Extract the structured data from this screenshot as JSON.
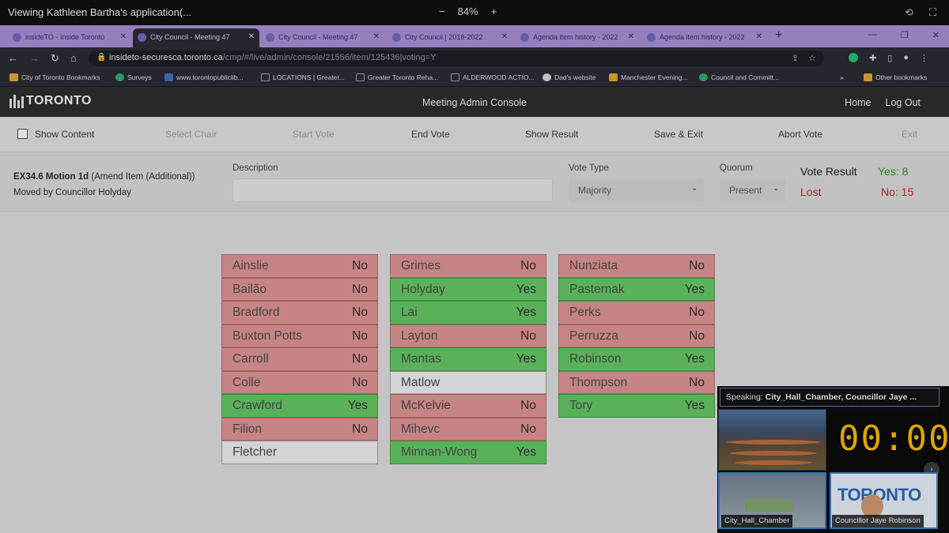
{
  "share": {
    "title": "Viewing Kathleen Bartha's application(...",
    "zoom_minus": "−",
    "zoom": "84%",
    "zoom_plus": "+"
  },
  "browser": {
    "tabs": [
      {
        "label": "insideTO - Inside Toronto",
        "active": false
      },
      {
        "label": "City Council - Meeting 47",
        "active": true
      },
      {
        "label": "City Council - Meeting 47",
        "active": false
      },
      {
        "label": "City Council | 2018-2022",
        "active": false
      },
      {
        "label": "Agenda item history - 2022",
        "active": false
      },
      {
        "label": "Agenda item history - 2022",
        "active": false
      }
    ],
    "url_host": "insideto-securesca.toronto.ca",
    "url_path": "/cmp/#/live/admin/console/21556/item/125436|voting=Y",
    "bookmarks": [
      "City of Toronto Bookmarks",
      "Surveys",
      "www.torontopubliclib...",
      "LOCATIONS | Greater...",
      "Greater Toronto Reha...",
      "ALDERWOOD ACTIO...",
      "Dad's website",
      "Manchester Evening...",
      "Council and Committ..."
    ],
    "bookmarks_more": "»",
    "other_bookmarks": "Other bookmarks"
  },
  "app": {
    "logo_text": "TORONTO",
    "title": "Meeting Admin Console",
    "home": "Home",
    "logout": "Log Out"
  },
  "toolbar": {
    "show_content": "Show Content",
    "select_chair": "Select Chair",
    "start_vote": "Start Vote",
    "end_vote": "End Vote",
    "show_result": "Show Result",
    "save_exit": "Save & Exit",
    "abort_vote": "Abort Vote",
    "exit": "Exit"
  },
  "info": {
    "motion_id": "EX34.6 Motion 1d",
    "motion_type": "(Amend Item (Additional))",
    "moved_by": "Moved by Councillor Holyday",
    "description_label": "Description",
    "description_value": "",
    "vote_type_label": "Vote Type",
    "vote_type_value": "Majority",
    "quorum_label": "Quorum",
    "quorum_value": "Present",
    "vote_result_label": "Vote Result",
    "yes_result": "Yes: 8",
    "outcome": "Lost",
    "no_result": "No: 15"
  },
  "colors": {
    "no": "#d79090",
    "yes": "#62c062",
    "none": "#e6e6e6",
    "lost": "#d11d1d",
    "yes_text": "#2a8f2a"
  },
  "votes": [
    [
      {
        "name": "Ainslie",
        "vote": "No"
      },
      {
        "name": "Bailão",
        "vote": "No"
      },
      {
        "name": "Bradford",
        "vote": "No"
      },
      {
        "name": "Buxton Potts",
        "vote": "No"
      },
      {
        "name": "Carroll",
        "vote": "No"
      },
      {
        "name": "Colle",
        "vote": "No"
      },
      {
        "name": "Crawford",
        "vote": "Yes"
      },
      {
        "name": "Filion",
        "vote": "No"
      },
      {
        "name": "Fletcher",
        "vote": ""
      }
    ],
    [
      {
        "name": "Grimes",
        "vote": "No"
      },
      {
        "name": "Holyday",
        "vote": "Yes"
      },
      {
        "name": "Lai",
        "vote": "Yes"
      },
      {
        "name": "Layton",
        "vote": "No"
      },
      {
        "name": "Mantas",
        "vote": "Yes"
      },
      {
        "name": "Matlow",
        "vote": ""
      },
      {
        "name": "McKelvie",
        "vote": "No"
      },
      {
        "name": "Mihevc",
        "vote": "No"
      },
      {
        "name": "Minnan-Wong",
        "vote": "Yes"
      }
    ],
    [
      {
        "name": "Nunziata",
        "vote": "No"
      },
      {
        "name": "Pasternak",
        "vote": "Yes"
      },
      {
        "name": "Perks",
        "vote": "No"
      },
      {
        "name": "Perruzza",
        "vote": "No"
      },
      {
        "name": "Robinson",
        "vote": "Yes"
      },
      {
        "name": "Thompson",
        "vote": "No"
      },
      {
        "name": "Tory",
        "vote": "Yes"
      }
    ]
  ],
  "speaker": {
    "label": "Speaking:",
    "value": "City_Hall_Chamber, Councillor Jaye ...",
    "timer": "00:00",
    "thumb_chamber": "City_Hall_Chamber",
    "thumb_councillor": "Councillor Jaye Robinson",
    "thumb_logo": "TORONTO"
  }
}
